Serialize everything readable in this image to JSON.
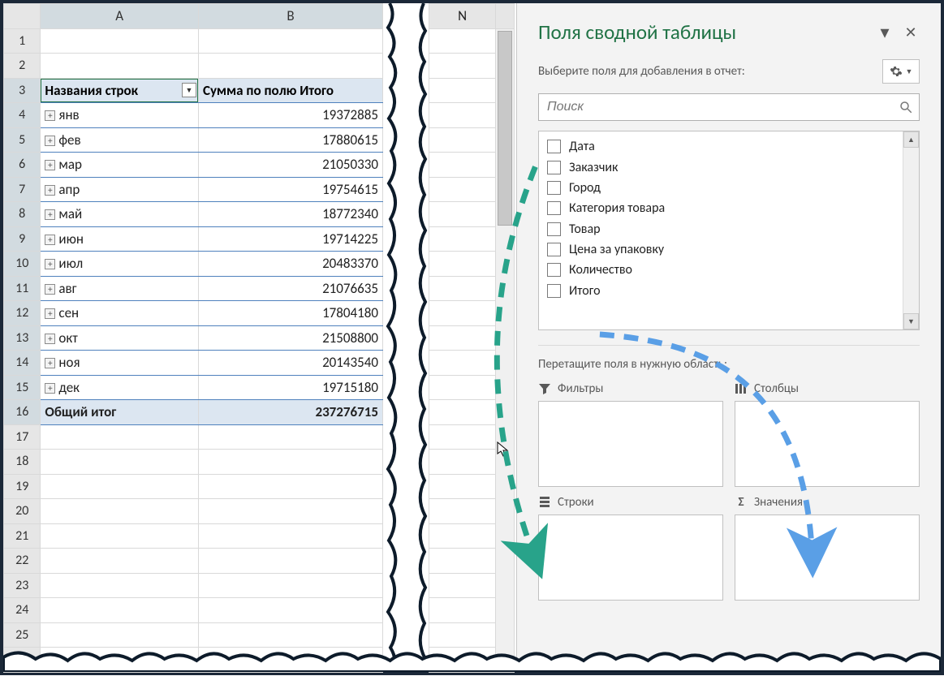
{
  "sheet": {
    "columns": [
      "A",
      "B"
    ],
    "mid_column": "N",
    "header": {
      "rownames": "Названия строк",
      "sum": "Сумма по полю Итого"
    },
    "rows": [
      {
        "label": "янв",
        "value": "19372885"
      },
      {
        "label": "фев",
        "value": "17880615"
      },
      {
        "label": "мар",
        "value": "21050330"
      },
      {
        "label": "апр",
        "value": "19754615"
      },
      {
        "label": "май",
        "value": "18772340"
      },
      {
        "label": "июн",
        "value": "19714225"
      },
      {
        "label": "июл",
        "value": "20483370"
      },
      {
        "label": "авг",
        "value": "21076635"
      },
      {
        "label": "сен",
        "value": "17804180"
      },
      {
        "label": "окт",
        "value": "21508800"
      },
      {
        "label": "ноя",
        "value": "20143540"
      },
      {
        "label": "дек",
        "value": "19715180"
      }
    ],
    "total": {
      "label": "Общий итог",
      "value": "237276715"
    },
    "blank_rows": 10
  },
  "pane": {
    "title": "Поля сводной таблицы",
    "subtitle": "Выберите поля для добавления в отчет:",
    "search_placeholder": "Поиск",
    "fields": [
      "Дата",
      "Заказчик",
      "Город",
      "Категория товара",
      "Товар",
      "Цена за упаковку",
      "Количество",
      "Итого"
    ],
    "drag_hint": "Перетащите поля в нужную область:",
    "zones": {
      "filters": "Фильтры",
      "columns": "Столбцы",
      "rows": "Строки",
      "values": "Значения"
    }
  }
}
